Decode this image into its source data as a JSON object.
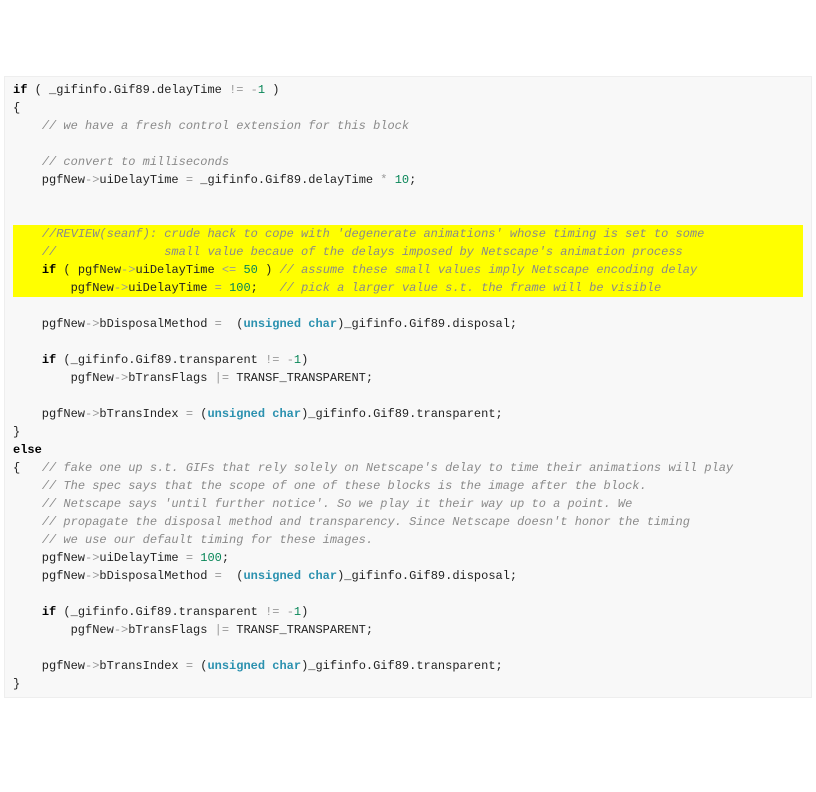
{
  "code": {
    "lines": [
      {
        "cls": "first-line",
        "tokens": [
          {
            "t": "kw",
            "s": "if"
          },
          {
            "t": "id",
            "s": " ( _gifinfo."
          },
          {
            "t": "id",
            "s": "Gif89"
          },
          {
            "t": "id",
            "s": "."
          },
          {
            "t": "id",
            "s": "delayTime"
          },
          {
            "t": "id",
            "s": " "
          },
          {
            "t": "op",
            "s": "!="
          },
          {
            "t": "id",
            "s": " "
          },
          {
            "t": "op",
            "s": "-"
          },
          {
            "t": "num",
            "s": "1"
          },
          {
            "t": "id",
            "s": " )"
          }
        ]
      },
      {
        "cls": "",
        "tokens": [
          {
            "t": "id",
            "s": "{"
          }
        ]
      },
      {
        "cls": "",
        "tokens": [
          {
            "t": "id",
            "s": "    "
          },
          {
            "t": "cm",
            "s": "// we have a fresh control extension for this block"
          }
        ]
      },
      {
        "cls": "",
        "tokens": [
          {
            "t": "id",
            "s": " "
          }
        ]
      },
      {
        "cls": "",
        "tokens": [
          {
            "t": "id",
            "s": "    "
          },
          {
            "t": "cm",
            "s": "// convert to milliseconds"
          }
        ]
      },
      {
        "cls": "",
        "tokens": [
          {
            "t": "id",
            "s": "    pgfNew"
          },
          {
            "t": "op",
            "s": "->"
          },
          {
            "t": "id",
            "s": "uiDelayTime "
          },
          {
            "t": "op",
            "s": "="
          },
          {
            "t": "id",
            "s": " _gifinfo."
          },
          {
            "t": "id",
            "s": "Gif89"
          },
          {
            "t": "id",
            "s": "."
          },
          {
            "t": "id",
            "s": "delayTime "
          },
          {
            "t": "op",
            "s": "*"
          },
          {
            "t": "id",
            "s": " "
          },
          {
            "t": "num",
            "s": "10"
          },
          {
            "t": "id",
            "s": ";"
          }
        ]
      },
      {
        "cls": "",
        "tokens": [
          {
            "t": "id",
            "s": " "
          }
        ]
      },
      {
        "cls": "",
        "tokens": [
          {
            "t": "id",
            "s": " "
          }
        ]
      },
      {
        "cls": "hl",
        "tokens": [
          {
            "t": "id",
            "s": "    "
          },
          {
            "t": "cm",
            "s": "//REVIEW(seanf): crude hack to cope with 'degenerate animations' whose timing is set to some"
          }
        ]
      },
      {
        "cls": "hl",
        "tokens": [
          {
            "t": "id",
            "s": "    "
          },
          {
            "t": "cm",
            "s": "//               small value becaue of the delays imposed by Netscape's animation process"
          }
        ]
      },
      {
        "cls": "hl",
        "tokens": [
          {
            "t": "id",
            "s": "    "
          },
          {
            "t": "kw",
            "s": "if"
          },
          {
            "t": "id",
            "s": " ( pgfNew"
          },
          {
            "t": "op",
            "s": "->"
          },
          {
            "t": "id",
            "s": "uiDelayTime "
          },
          {
            "t": "op",
            "s": "<="
          },
          {
            "t": "id",
            "s": " "
          },
          {
            "t": "num",
            "s": "50"
          },
          {
            "t": "id",
            "s": " ) "
          },
          {
            "t": "cm",
            "s": "// assume these small values imply Netscape encoding delay"
          }
        ]
      },
      {
        "cls": "hl",
        "tokens": [
          {
            "t": "id",
            "s": "        pgfNew"
          },
          {
            "t": "op",
            "s": "->"
          },
          {
            "t": "id",
            "s": "uiDelayTime "
          },
          {
            "t": "op",
            "s": "="
          },
          {
            "t": "id",
            "s": " "
          },
          {
            "t": "num",
            "s": "100"
          },
          {
            "t": "id",
            "s": ";   "
          },
          {
            "t": "cm",
            "s": "// pick a larger value s.t. the frame will be visible"
          }
        ]
      },
      {
        "cls": "",
        "tokens": [
          {
            "t": "id",
            "s": " "
          }
        ]
      },
      {
        "cls": "",
        "tokens": [
          {
            "t": "id",
            "s": "    pgfNew"
          },
          {
            "t": "op",
            "s": "->"
          },
          {
            "t": "id",
            "s": "bDisposalMethod "
          },
          {
            "t": "op",
            "s": "="
          },
          {
            "t": "id",
            "s": "  ("
          },
          {
            "t": "ty",
            "s": "unsigned"
          },
          {
            "t": "id",
            "s": " "
          },
          {
            "t": "ty",
            "s": "char"
          },
          {
            "t": "id",
            "s": ")_gifinfo."
          },
          {
            "t": "id",
            "s": "Gif89"
          },
          {
            "t": "id",
            "s": "."
          },
          {
            "t": "id",
            "s": "disposal;"
          }
        ]
      },
      {
        "cls": "",
        "tokens": [
          {
            "t": "id",
            "s": " "
          }
        ]
      },
      {
        "cls": "",
        "tokens": [
          {
            "t": "id",
            "s": "    "
          },
          {
            "t": "kw",
            "s": "if"
          },
          {
            "t": "id",
            "s": " (_gifinfo."
          },
          {
            "t": "id",
            "s": "Gif89"
          },
          {
            "t": "id",
            "s": "."
          },
          {
            "t": "id",
            "s": "transparent "
          },
          {
            "t": "op",
            "s": "!="
          },
          {
            "t": "id",
            "s": " "
          },
          {
            "t": "op",
            "s": "-"
          },
          {
            "t": "num",
            "s": "1"
          },
          {
            "t": "id",
            "s": ")"
          }
        ]
      },
      {
        "cls": "",
        "tokens": [
          {
            "t": "id",
            "s": "        pgfNew"
          },
          {
            "t": "op",
            "s": "->"
          },
          {
            "t": "id",
            "s": "bTransFlags "
          },
          {
            "t": "op",
            "s": "|="
          },
          {
            "t": "id",
            "s": " TRANSF_TRANSPARENT;"
          }
        ]
      },
      {
        "cls": "",
        "tokens": [
          {
            "t": "id",
            "s": " "
          }
        ]
      },
      {
        "cls": "",
        "tokens": [
          {
            "t": "id",
            "s": "    pgfNew"
          },
          {
            "t": "op",
            "s": "->"
          },
          {
            "t": "id",
            "s": "bTransIndex "
          },
          {
            "t": "op",
            "s": "="
          },
          {
            "t": "id",
            "s": " ("
          },
          {
            "t": "ty",
            "s": "unsigned"
          },
          {
            "t": "id",
            "s": " "
          },
          {
            "t": "ty",
            "s": "char"
          },
          {
            "t": "id",
            "s": ")_gifinfo."
          },
          {
            "t": "id",
            "s": "Gif89"
          },
          {
            "t": "id",
            "s": "."
          },
          {
            "t": "id",
            "s": "transparent;"
          }
        ]
      },
      {
        "cls": "",
        "tokens": [
          {
            "t": "id",
            "s": "}"
          }
        ]
      },
      {
        "cls": "",
        "tokens": [
          {
            "t": "kw",
            "s": "else"
          }
        ]
      },
      {
        "cls": "",
        "tokens": [
          {
            "t": "id",
            "s": "{   "
          },
          {
            "t": "cm",
            "s": "// fake one up s.t. GIFs that rely solely on Netscape's delay to time their animations will play"
          }
        ]
      },
      {
        "cls": "",
        "tokens": [
          {
            "t": "id",
            "s": "    "
          },
          {
            "t": "cm",
            "s": "// The spec says that the scope of one of these blocks is the image after the block."
          }
        ]
      },
      {
        "cls": "",
        "tokens": [
          {
            "t": "id",
            "s": "    "
          },
          {
            "t": "cm",
            "s": "// Netscape says 'until further notice'. So we play it their way up to a point. We"
          }
        ]
      },
      {
        "cls": "",
        "tokens": [
          {
            "t": "id",
            "s": "    "
          },
          {
            "t": "cm",
            "s": "// propagate the disposal method and transparency. Since Netscape doesn't honor the timing"
          }
        ]
      },
      {
        "cls": "",
        "tokens": [
          {
            "t": "id",
            "s": "    "
          },
          {
            "t": "cm",
            "s": "// we use our default timing for these images."
          }
        ]
      },
      {
        "cls": "",
        "tokens": [
          {
            "t": "id",
            "s": "    pgfNew"
          },
          {
            "t": "op",
            "s": "->"
          },
          {
            "t": "id",
            "s": "uiDelayTime "
          },
          {
            "t": "op",
            "s": "="
          },
          {
            "t": "id",
            "s": " "
          },
          {
            "t": "num",
            "s": "100"
          },
          {
            "t": "id",
            "s": ";"
          }
        ]
      },
      {
        "cls": "",
        "tokens": [
          {
            "t": "id",
            "s": "    pgfNew"
          },
          {
            "t": "op",
            "s": "->"
          },
          {
            "t": "id",
            "s": "bDisposalMethod "
          },
          {
            "t": "op",
            "s": "="
          },
          {
            "t": "id",
            "s": "  ("
          },
          {
            "t": "ty",
            "s": "unsigned"
          },
          {
            "t": "id",
            "s": " "
          },
          {
            "t": "ty",
            "s": "char"
          },
          {
            "t": "id",
            "s": ")_gifinfo."
          },
          {
            "t": "id",
            "s": "Gif89"
          },
          {
            "t": "id",
            "s": "."
          },
          {
            "t": "id",
            "s": "disposal;"
          }
        ]
      },
      {
        "cls": "",
        "tokens": [
          {
            "t": "id",
            "s": " "
          }
        ]
      },
      {
        "cls": "",
        "tokens": [
          {
            "t": "id",
            "s": "    "
          },
          {
            "t": "kw",
            "s": "if"
          },
          {
            "t": "id",
            "s": " (_gifinfo."
          },
          {
            "t": "id",
            "s": "Gif89"
          },
          {
            "t": "id",
            "s": "."
          },
          {
            "t": "id",
            "s": "transparent "
          },
          {
            "t": "op",
            "s": "!="
          },
          {
            "t": "id",
            "s": " "
          },
          {
            "t": "op",
            "s": "-"
          },
          {
            "t": "num",
            "s": "1"
          },
          {
            "t": "id",
            "s": ")"
          }
        ]
      },
      {
        "cls": "",
        "tokens": [
          {
            "t": "id",
            "s": "        pgfNew"
          },
          {
            "t": "op",
            "s": "->"
          },
          {
            "t": "id",
            "s": "bTransFlags "
          },
          {
            "t": "op",
            "s": "|="
          },
          {
            "t": "id",
            "s": " TRANSF_TRANSPARENT;"
          }
        ]
      },
      {
        "cls": "",
        "tokens": [
          {
            "t": "id",
            "s": " "
          }
        ]
      },
      {
        "cls": "",
        "tokens": [
          {
            "t": "id",
            "s": "    pgfNew"
          },
          {
            "t": "op",
            "s": "->"
          },
          {
            "t": "id",
            "s": "bTransIndex "
          },
          {
            "t": "op",
            "s": "="
          },
          {
            "t": "id",
            "s": " ("
          },
          {
            "t": "ty",
            "s": "unsigned"
          },
          {
            "t": "id",
            "s": " "
          },
          {
            "t": "ty",
            "s": "char"
          },
          {
            "t": "id",
            "s": ")_gifinfo."
          },
          {
            "t": "id",
            "s": "Gif89"
          },
          {
            "t": "id",
            "s": "."
          },
          {
            "t": "id",
            "s": "transparent;"
          }
        ]
      },
      {
        "cls": "",
        "tokens": [
          {
            "t": "id",
            "s": "}"
          }
        ]
      }
    ]
  }
}
